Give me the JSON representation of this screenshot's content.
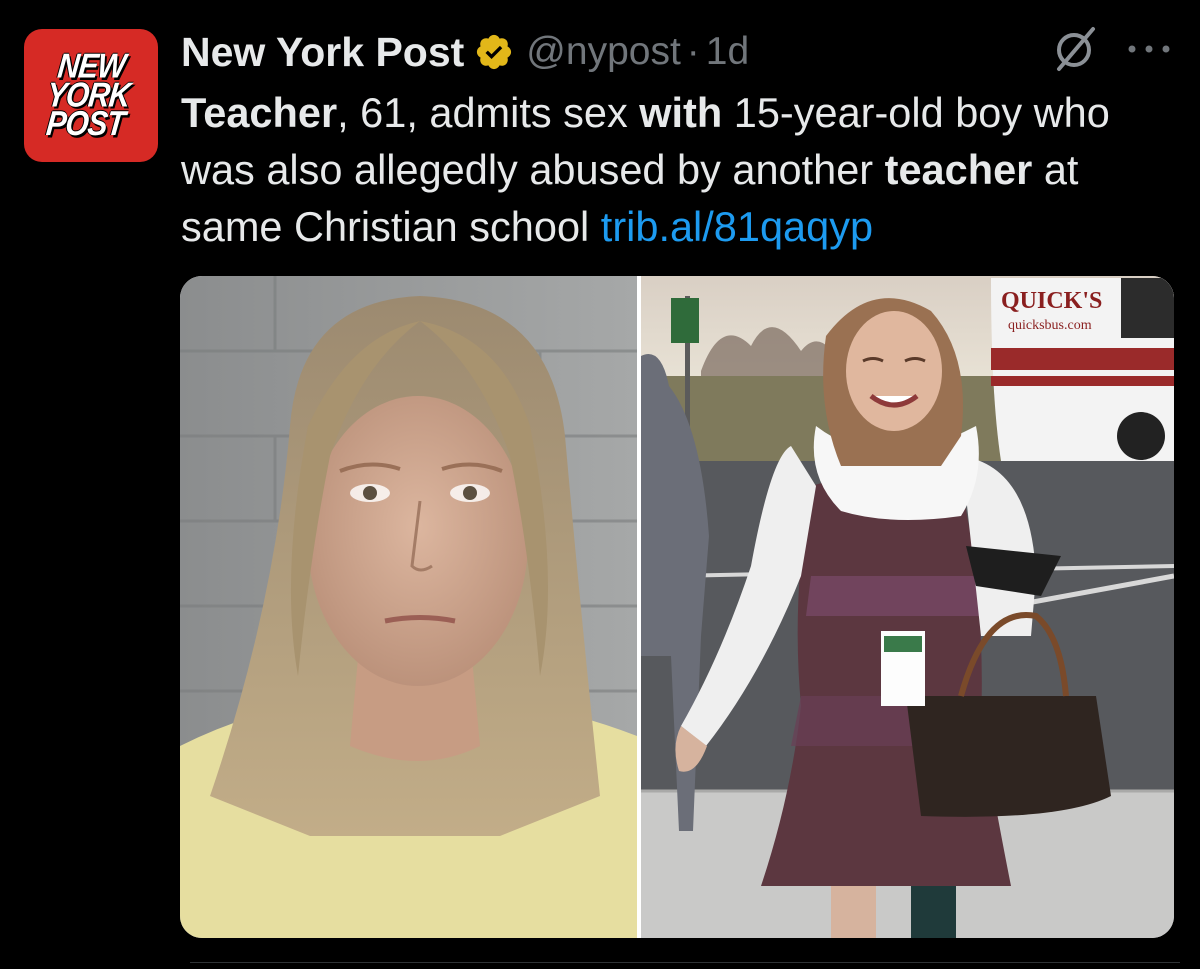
{
  "account": {
    "logo_text": "NEW\nYORK\nPOST",
    "name": "New York Post",
    "handle": "@nypost",
    "separator": "·",
    "time": "1d"
  },
  "tweet": {
    "part1": "Teacher",
    "part2": ", 61, admits sex ",
    "part3": "with",
    "part4": " 15-year-old boy who was also allegedly abused by another ",
    "part5": "teacher",
    "part6": " at same Christian school ",
    "link": "trib.al/81qaqyp"
  },
  "media": {
    "bus_sign": "QUICK'S",
    "bus_url": "quicksbus.com"
  },
  "icons": {
    "verified": "verified-badge-icon",
    "grok": "grok-icon",
    "more": "more-options-icon"
  },
  "colors": {
    "background": "#000000",
    "text": "#e7e9ea",
    "muted": "#71767b",
    "link": "#1d9bf0",
    "verified": "#e2b719",
    "logo": "#d62a25"
  }
}
